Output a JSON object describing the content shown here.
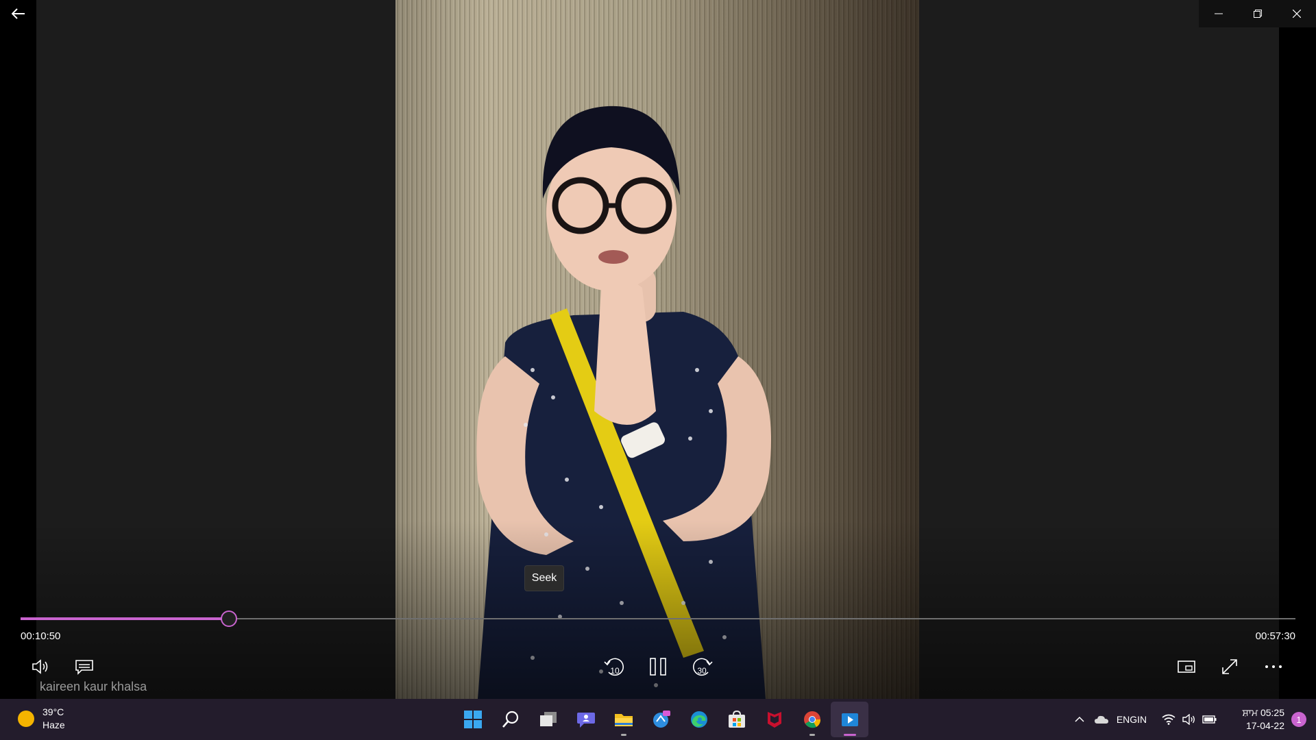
{
  "player": {
    "tooltip": "Seek",
    "time_current": "00:10:50",
    "time_total": "00:57:30",
    "progress_fraction": 0.163,
    "caption": "kaireen kaur khalsa",
    "skip_back_label": "10",
    "skip_forward_label": "30",
    "accent_color": "#c964cf"
  },
  "taskbar": {
    "weather_temp": "39°C",
    "weather_desc": "Haze",
    "lang_primary": "ENG",
    "lang_secondary": "IN",
    "clock_time": "ਸ਼ਾਮ 05:25",
    "clock_date": "17-04-22",
    "notification_count": "1",
    "apps": [
      "windows-start-icon",
      "search-icon",
      "task-view-icon",
      "chat-icon",
      "file-explorer-icon",
      "mail-calendar-icon",
      "edge-icon",
      "store-icon",
      "mcafee-icon",
      "chrome-icon",
      "media-player-icon"
    ]
  }
}
